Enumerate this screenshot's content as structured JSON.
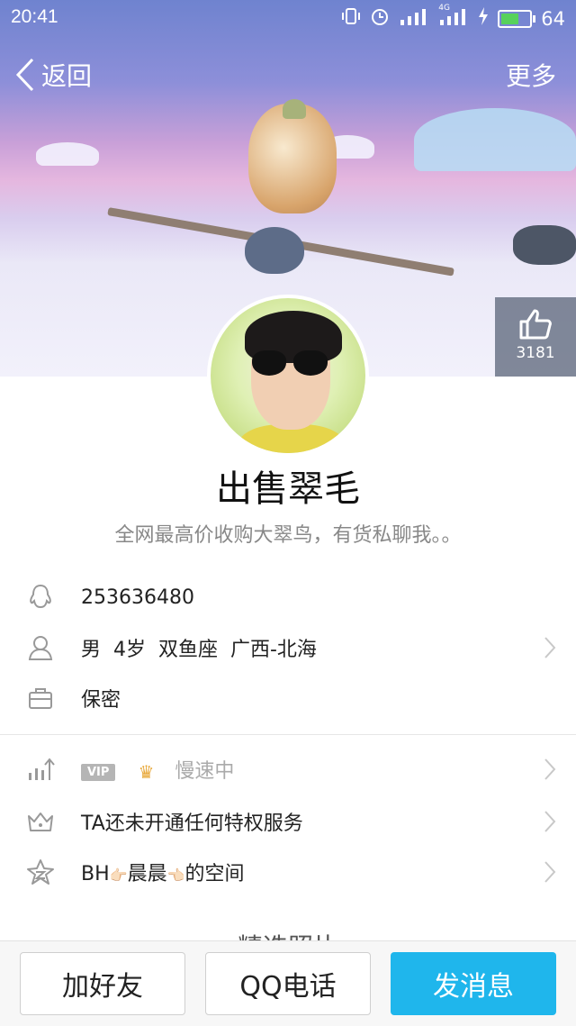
{
  "status_bar": {
    "time": "20:41",
    "battery": "64",
    "battery_level": 0.64,
    "signal_label": "4G"
  },
  "nav": {
    "back_label": "返回",
    "more_label": "更多"
  },
  "like": {
    "count": "3181"
  },
  "profile": {
    "name": "出售翠毛",
    "signature": "全网最高价收购大翠鸟，有货私聊我。。"
  },
  "info_rows": [
    {
      "icon": "qq-penguin-icon",
      "text": "253636480"
    },
    {
      "icon": "person-icon",
      "text": "男  4岁  双鱼座  广西-北海"
    },
    {
      "icon": "briefcase-icon",
      "text": "保密"
    }
  ],
  "vip_row": {
    "badge": "VIP",
    "status": "慢速中"
  },
  "privilege_row": {
    "text": "TA还未开通任何特权服务"
  },
  "space_row": {
    "prefix": "BH",
    "emoji_left": "👉🏻",
    "middle": "晨晨",
    "emoji_right": "👈🏻",
    "suffix": "的空间"
  },
  "section_peek": "精选照片",
  "actions": {
    "add_friend": "加好友",
    "qq_call": "QQ电话",
    "send_message": "发消息"
  },
  "colors": {
    "primary": "#1fb6ec",
    "vip_grey": "#b5b5b5"
  }
}
